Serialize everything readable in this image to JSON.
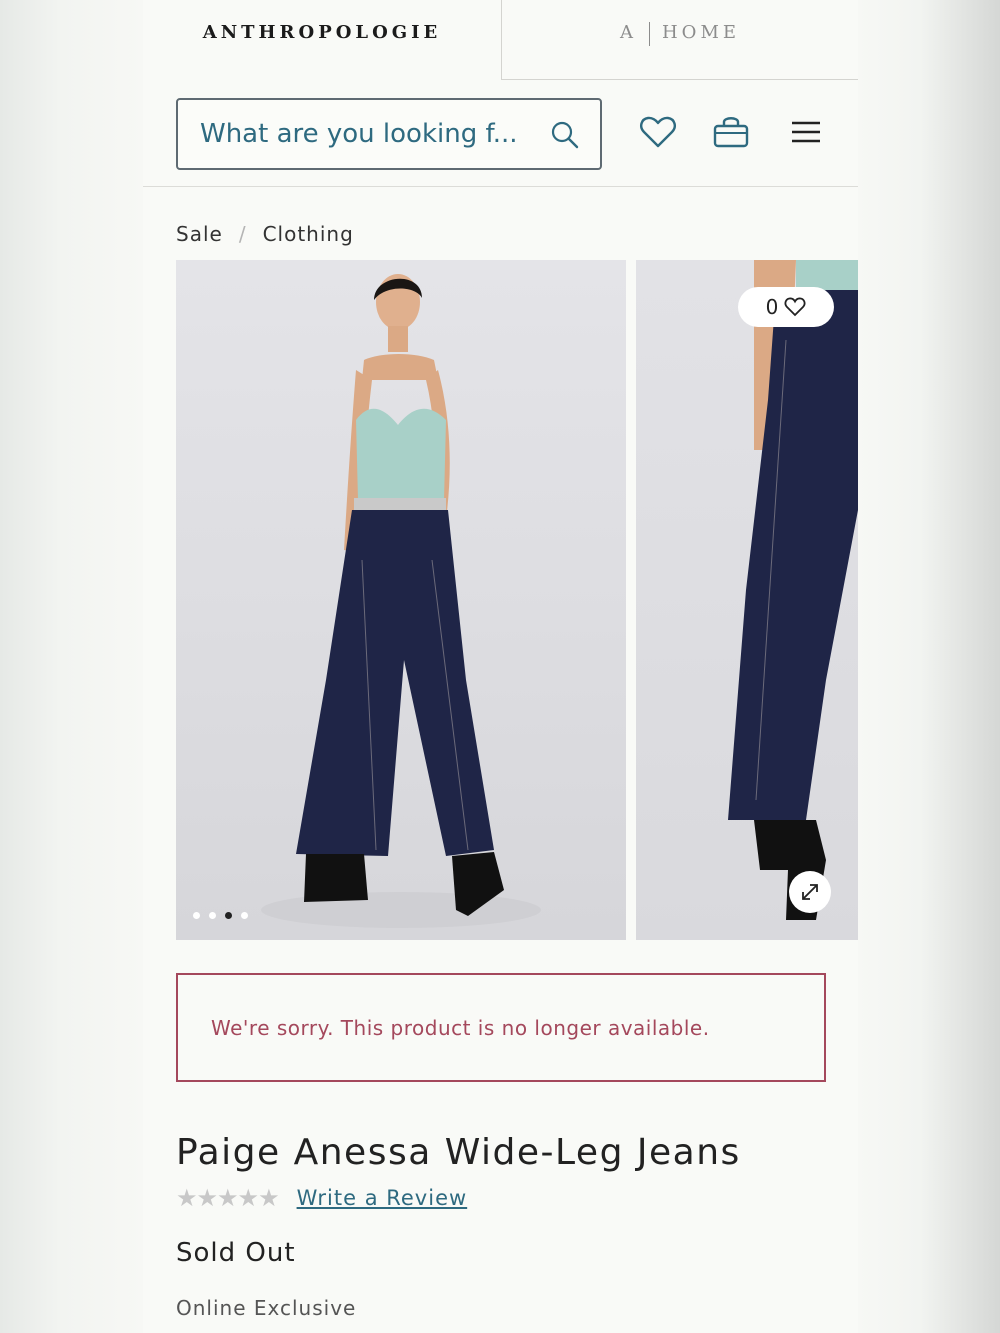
{
  "brand": {
    "primary": "ANTHROPOLOGIE",
    "secondary_a": "A",
    "secondary_home": "HOME"
  },
  "search": {
    "placeholder": "What are you looking f..."
  },
  "header_icons": [
    "heart-icon",
    "bag-icon",
    "menu-icon"
  ],
  "breadcrumb": {
    "items": [
      "Sale",
      "Clothing"
    ],
    "separator": "/"
  },
  "gallery": {
    "dots_total": 4,
    "active_dot": 3,
    "favorite_count": "0"
  },
  "notice": {
    "text": "We're sorry. This product is no longer available."
  },
  "product": {
    "title": "Paige Anessa Wide-Leg Jeans",
    "stars": "★★★★★",
    "rating_value": 0,
    "review_link": "Write a Review",
    "status": "Sold Out",
    "badge": "Online Exclusive"
  },
  "colors": {
    "accent": "#2e6a80",
    "alert": "#a4485c",
    "denim": "#1f2547",
    "top": "#a8d0c8"
  }
}
